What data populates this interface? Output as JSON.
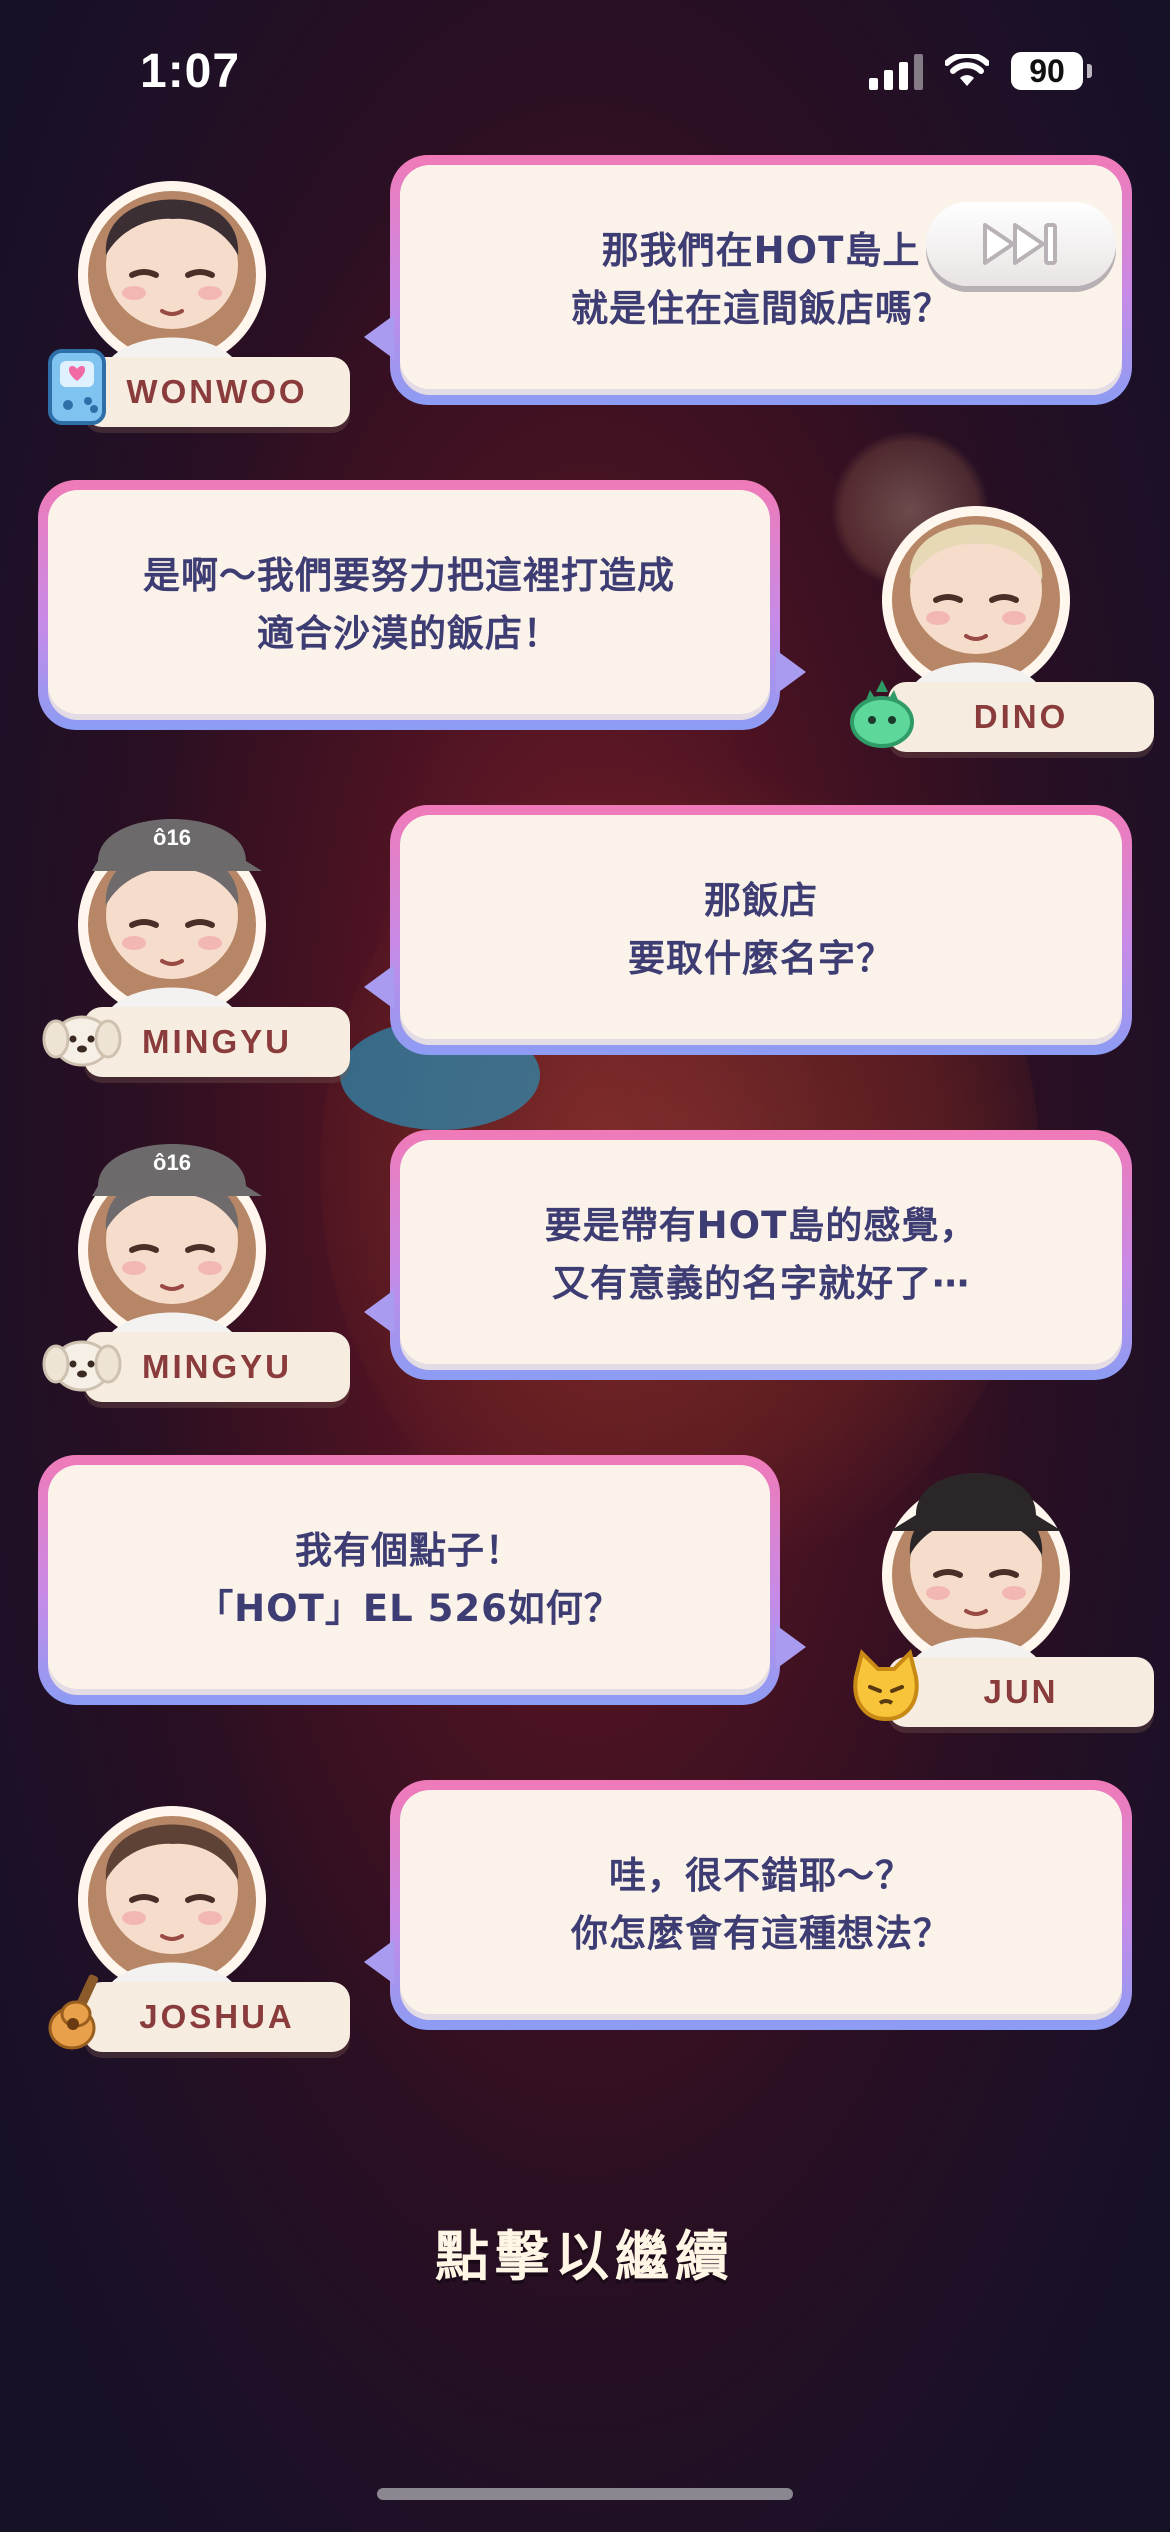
{
  "status_bar": {
    "time": "1:07",
    "battery": "90"
  },
  "skip_button": {
    "icon": "fast-forward-icon"
  },
  "dialogue": [
    {
      "speaker": "WONWOO",
      "side": "left",
      "badge": "game-console-icon",
      "lines": [
        "那我們在HOT島上",
        "就是住在這間飯店嗎？"
      ]
    },
    {
      "speaker": "DINO",
      "side": "right",
      "badge": "green-dino-icon",
      "lines": [
        "是啊～我們要努力把這裡打造成",
        "適合沙漠的飯店！"
      ]
    },
    {
      "speaker": "MINGYU",
      "side": "left",
      "badge": "puppy-icon",
      "lines": [
        "那飯店",
        "要取什麼名字？"
      ]
    },
    {
      "speaker": "MINGYU",
      "side": "left",
      "badge": "puppy-icon",
      "lines": [
        "要是帶有HOT島的感覺，",
        "又有意義的名字就好了⋯"
      ]
    },
    {
      "speaker": "JUN",
      "side": "right",
      "badge": "cat-icon",
      "lines": [
        "我有個點子！",
        "「HOT」EL 526如何？"
      ]
    },
    {
      "speaker": "JOSHUA",
      "side": "left",
      "badge": "guitar-icon",
      "lines": [
        "哇，很不錯耶～？",
        "你怎麼會有這種想法？"
      ]
    }
  ],
  "prompt": {
    "label": "點擊以繼續"
  }
}
